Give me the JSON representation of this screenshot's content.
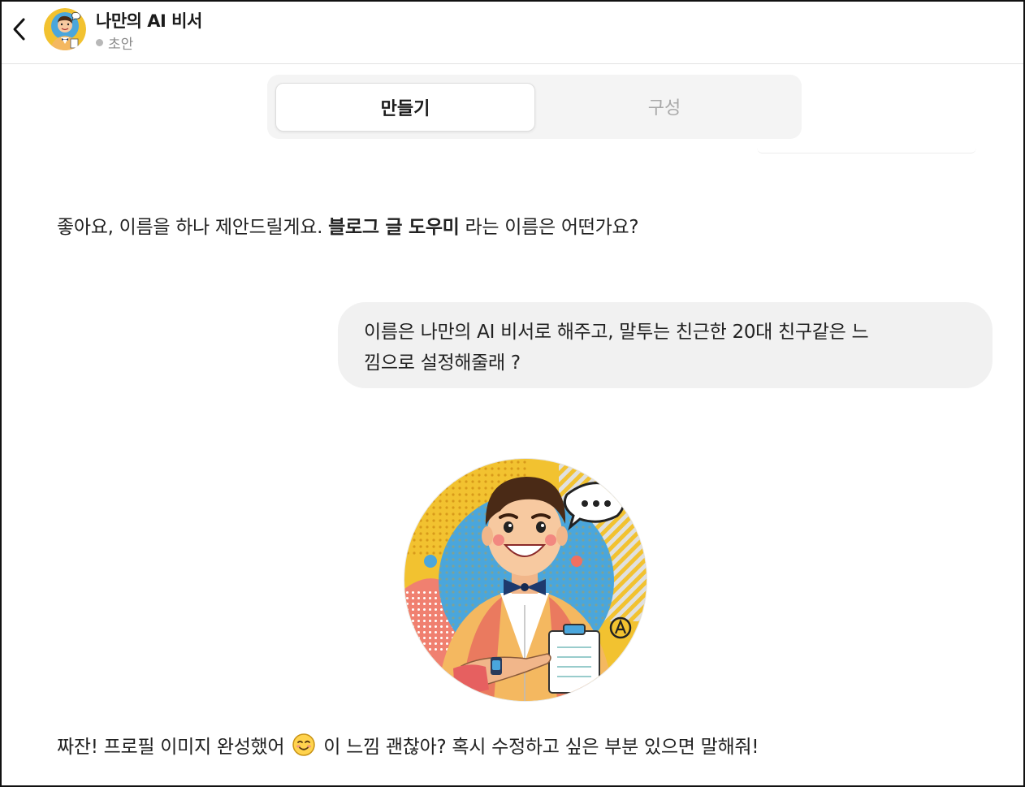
{
  "header": {
    "title": "나만의 AI 비서",
    "status": "초안"
  },
  "tabs": [
    {
      "label": "만들기",
      "active": true
    },
    {
      "label": "구성",
      "active": false
    }
  ],
  "messages": {
    "assistant_1": {
      "prefix": "좋아요, 이름을 하나 제안드릴게요. ",
      "bold": "블로그 글 도우미",
      "suffix": " 라는 이름은 어떤가요?"
    },
    "user_1": {
      "line1": "이름은 나만의 AI 비서로 해주고, 말투는 친근한 20대 친구같은 느",
      "line2": "낌으로 설정해줄래 ?"
    },
    "assistant_2": {
      "prefix": "짜잔! 프로필 이미지 완성했어",
      "emoji": "smiling-face-emoji",
      "suffix": "이 느낌 괜찮아? 혹시 수정하고 싶은 부분 있으면 말해줘!"
    }
  },
  "colors": {
    "tab_bg": "#f4f4f4",
    "bubble_bg": "#f1f1f1",
    "avatar_yellow": "#f2c230",
    "avatar_blue": "#4aa6dc",
    "cardigan": "#f4b860",
    "bowtie": "#1e3a6e"
  },
  "icons": {
    "back": "chevron-left-icon"
  }
}
